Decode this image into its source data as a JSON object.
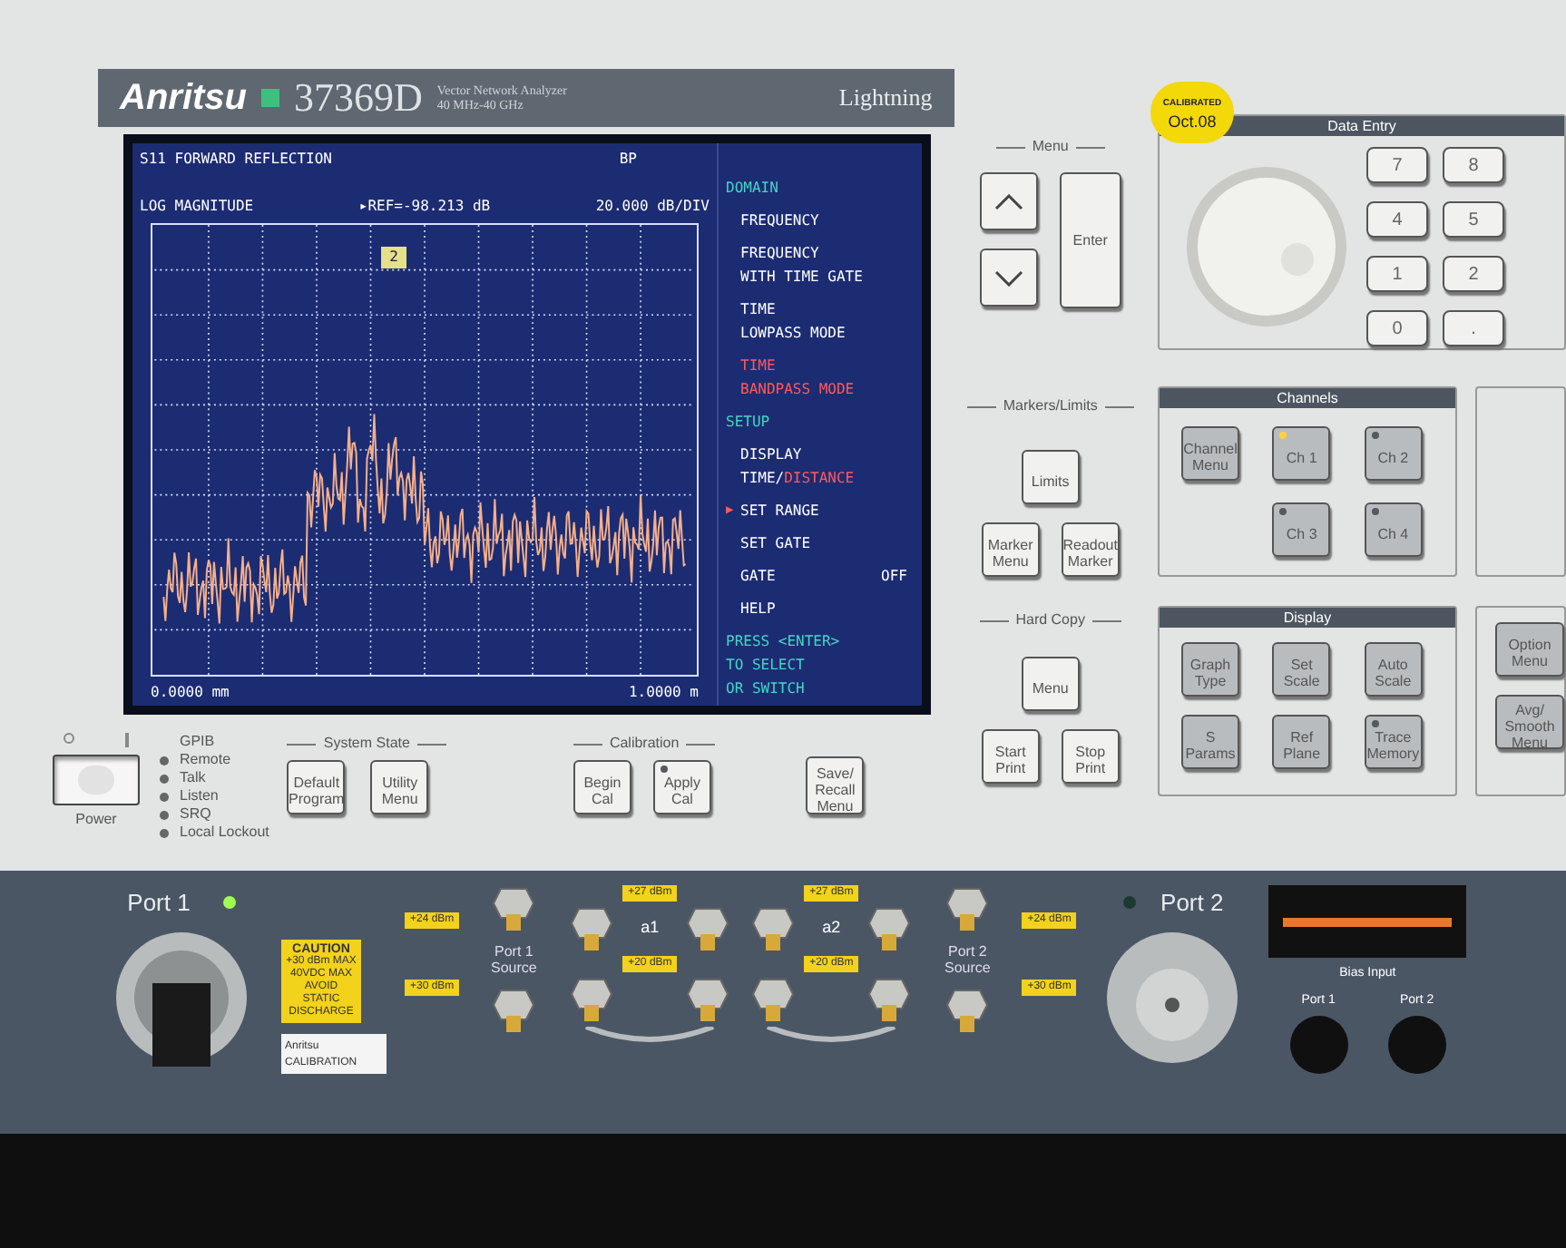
{
  "header": {
    "brand": "Anritsu",
    "model": "37369D",
    "subtitle_lines": [
      "Vector Network Analyzer",
      "40 MHz-40 GHz"
    ],
    "series": "Lightning"
  },
  "screen": {
    "title": "S11 FORWARD REFLECTION",
    "mode": "BP",
    "trace_format": "LOG MAGNITUDE",
    "reference_pointer": "▸",
    "reference": "REF=-98.213 dB",
    "selection_pointer": "▶",
    "scale": "20.000 dB/DIV",
    "marker": "2",
    "x_start": "0.0000 mm",
    "x_end": "1.0000 m",
    "menu": [
      {
        "kind": "heading",
        "lines": [
          [
            {
              "text": "DOMAIN",
              "active": false
            }
          ]
        ]
      },
      {
        "kind": "item",
        "selected": false,
        "lines": [
          [
            {
              "text": "FREQUENCY",
              "active": false
            }
          ]
        ]
      },
      {
        "kind": "item",
        "selected": false,
        "lines": [
          [
            {
              "text": "FREQUENCY",
              "active": false
            }
          ],
          [
            {
              "text": "WITH TIME GATE",
              "active": false
            }
          ]
        ]
      },
      {
        "kind": "item",
        "selected": false,
        "lines": [
          [
            {
              "text": "TIME",
              "active": false
            }
          ],
          [
            {
              "text": "LOWPASS MODE",
              "active": false
            }
          ]
        ]
      },
      {
        "kind": "item",
        "selected": false,
        "lines": [
          [
            {
              "text": "TIME",
              "active": true
            }
          ],
          [
            {
              "text": "BANDPASS MODE",
              "active": true
            }
          ]
        ]
      },
      {
        "kind": "heading",
        "lines": [
          [
            {
              "text": "SETUP",
              "active": false
            }
          ]
        ]
      },
      {
        "kind": "item",
        "selected": false,
        "lines": [
          [
            {
              "text": "DISPLAY",
              "active": false
            }
          ],
          [
            {
              "text": "TIME/",
              "active": false
            },
            {
              "text": "DISTANCE",
              "active": true
            }
          ]
        ]
      },
      {
        "kind": "item",
        "selected": true,
        "lines": [
          [
            {
              "text": "SET RANGE",
              "active": false
            }
          ]
        ]
      },
      {
        "kind": "item",
        "selected": false,
        "lines": [
          [
            {
              "text": "SET GATE",
              "active": false
            }
          ]
        ]
      },
      {
        "kind": "item",
        "selected": false,
        "value": "OFF",
        "lines": [
          [
            {
              "text": "GATE",
              "active": false
            }
          ]
        ]
      },
      {
        "kind": "item",
        "selected": false,
        "lines": [
          [
            {
              "text": "HELP",
              "active": false
            }
          ]
        ]
      },
      {
        "kind": "hint",
        "lines": [
          [
            {
              "text": "PRESS <ENTER>",
              "active": false
            }
          ],
          [
            {
              "text": "TO SELECT",
              "active": false
            }
          ],
          [
            {
              "text": "OR SWITCH",
              "active": false
            }
          ]
        ]
      }
    ]
  },
  "power": {
    "label": "Power",
    "on": true
  },
  "gpib": {
    "title": "GPIB",
    "leds": [
      {
        "label": "Remote",
        "on": false
      },
      {
        "label": "Talk",
        "on": false
      },
      {
        "label": "Listen",
        "on": false
      },
      {
        "label": "SRQ",
        "on": false
      },
      {
        "label": "Local Lockout",
        "on": false
      }
    ]
  },
  "system_state": {
    "title": "System State",
    "buttons": [
      {
        "label": "Default Program"
      },
      {
        "label": "Utility Menu"
      }
    ]
  },
  "calibration": {
    "title": "Calibration",
    "buttons": [
      {
        "label": "Begin Cal"
      },
      {
        "label": "Apply Cal",
        "lit": false
      }
    ]
  },
  "save_recall": {
    "label": "Save/ Recall Menu"
  },
  "sticker": {
    "lines": [
      "CALIBRATED",
      "Oct.08"
    ]
  },
  "menu_keys": {
    "title": "Menu",
    "enter": "Enter"
  },
  "data_entry": {
    "title": "Data Entry",
    "keys": [
      "7",
      "8",
      "4",
      "5",
      "1",
      "2",
      "0",
      "."
    ]
  },
  "markers_limits": {
    "title": "Markers/Limits",
    "buttons": [
      {
        "label": "Limits"
      },
      {
        "label": "Marker Menu"
      },
      {
        "label": "Readout Marker"
      }
    ]
  },
  "channels": {
    "title": "Channels",
    "buttons": [
      {
        "label": "Channel Menu"
      },
      {
        "label": "Ch 1",
        "lit": true
      },
      {
        "label": "Ch 2",
        "lit": false
      },
      {
        "label": "Ch 3",
        "lit": false
      },
      {
        "label": "Ch 4",
        "lit": false
      }
    ]
  },
  "hard_copy": {
    "title": "Hard Copy",
    "buttons": [
      {
        "label": "Menu"
      },
      {
        "label": "Start Print"
      },
      {
        "label": "Stop Print"
      }
    ]
  },
  "display": {
    "title": "Display",
    "buttons": [
      {
        "label": "Graph Type"
      },
      {
        "label": "Set Scale"
      },
      {
        "label": "Auto Scale"
      },
      {
        "label": "S Params"
      },
      {
        "label": "Ref Plane"
      },
      {
        "label": "Trace Memory",
        "lit": false
      }
    ]
  },
  "side_keys": {
    "buttons": [
      {
        "label": "Option Menu"
      },
      {
        "label": "Avg/ Smooth Menu"
      }
    ]
  },
  "ports": {
    "port_1": {
      "label": "Port 1",
      "led_on": true
    },
    "port_2": {
      "label": "Port 2",
      "led_on": false
    },
    "caution": [
      "CAUTION",
      "+30 dBm MAX",
      "40VDC MAX",
      "AVOID STATIC",
      "DISCHARGE"
    ],
    "port_1_source": "Port 1 Source",
    "port_2_source": "Port 2 Source",
    "limits_top": [
      "+24 dBm",
      "+27 dBm",
      "+27 dBm",
      "+24 dBm"
    ],
    "limits_mid": [
      "+20 dBm",
      "+20 dBm"
    ],
    "limits_bottom": [
      "+30 dBm",
      "+30 dBm"
    ],
    "loops": [
      "a1",
      "a2"
    ],
    "cal_label": "Anritsu CALIBRATION",
    "bias_title": "Bias Input",
    "bias_ports": [
      "Port 1",
      "Port 2"
    ]
  }
}
